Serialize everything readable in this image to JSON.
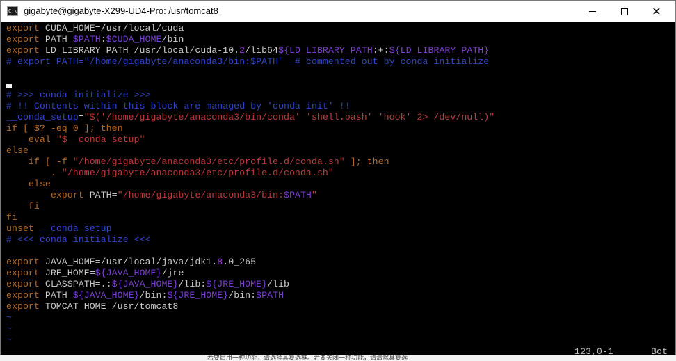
{
  "window": {
    "title": "gigabyte@gigabyte-X299-UD4-Pro: /usr/tomcat8",
    "icon": "console-icon",
    "controls": {
      "minimize": "minimize-icon",
      "maximize": "maximize-icon",
      "close": "close-icon"
    }
  },
  "colors": {
    "keyword": "#b2692a",
    "text": "#c8c8c8",
    "variable": "#7a3fd1",
    "comment": "#2f46c8",
    "string": "#bb3a3a",
    "blue_ident": "#2f46c8",
    "number": "#9a3fd1",
    "tilde": "#2f46c8",
    "cursor": "#f0f0f0"
  },
  "editor": {
    "lines": [
      [
        {
          "t": "export",
          "c": "keyword"
        },
        {
          "t": " CUDA_HOME=/usr/local/cuda",
          "c": "text"
        }
      ],
      [
        {
          "t": "export",
          "c": "keyword"
        },
        {
          "t": " PATH=",
          "c": "text"
        },
        {
          "t": "$PATH",
          "c": "variable"
        },
        {
          "t": ":",
          "c": "text"
        },
        {
          "t": "$CUDA_HOME",
          "c": "variable"
        },
        {
          "t": "/bin",
          "c": "text"
        }
      ],
      [
        {
          "t": "export",
          "c": "keyword"
        },
        {
          "t": " LD_LIBRARY_PATH=/usr/local/cuda-10.",
          "c": "text"
        },
        {
          "t": "2",
          "c": "number"
        },
        {
          "t": "/lib64",
          "c": "text"
        },
        {
          "t": "${LD_LIBRARY_PATH",
          ":": "",
          "c": "variable"
        },
        {
          "t": ":+:",
          "c": "text"
        },
        {
          "t": "${LD_LIBRARY_PATH}",
          "c": "variable"
        }
      ],
      [
        {
          "t": "# export PATH=\"/home/gigabyte/anaconda3/bin:$PATH\"  # commented out by conda initialize",
          "c": "comment"
        }
      ],
      [],
      [
        {
          "t": "",
          "c": "cursor"
        }
      ],
      [
        {
          "t": "# >>> conda initialize >>>",
          "c": "comment"
        }
      ],
      [
        {
          "t": "# !! Contents within this block are managed by 'conda init' !!",
          "c": "comment"
        }
      ],
      [
        {
          "t": "__conda_setup",
          "c": "blue_ident"
        },
        {
          "t": "=",
          "c": "text"
        },
        {
          "t": "\"$('/home/gigabyte/anaconda3/bin/conda' 'shell.bash' 'hook' 2> /dev/null)\"",
          "c": "string"
        }
      ],
      [
        {
          "t": "if [ $? -eq 0 ]; then",
          "c": "keyword"
        }
      ],
      [
        {
          "t": "    eval ",
          "c": "keyword"
        },
        {
          "t": "\"$__conda_setup\"",
          "c": "string"
        }
      ],
      [
        {
          "t": "else",
          "c": "keyword"
        }
      ],
      [
        {
          "t": "    if [ -f ",
          "c": "keyword"
        },
        {
          "t": "\"/home/gigabyte/anaconda3/etc/profile.d/conda.sh\"",
          "c": "string"
        },
        {
          "t": " ]; then",
          "c": "keyword"
        }
      ],
      [
        {
          "t": "        . ",
          "c": "keyword"
        },
        {
          "t": "\"/home/gigabyte/anaconda3/etc/profile.d/conda.sh\"",
          "c": "string"
        }
      ],
      [
        {
          "t": "    else",
          "c": "keyword"
        }
      ],
      [
        {
          "t": "        export",
          "c": "keyword"
        },
        {
          "t": " PATH=",
          "c": "text"
        },
        {
          "t": "\"/home/gigabyte/anaconda3/bin:",
          "c": "string"
        },
        {
          "t": "$PATH",
          "c": "variable"
        },
        {
          "t": "\"",
          "c": "string"
        }
      ],
      [
        {
          "t": "    fi",
          "c": "keyword"
        }
      ],
      [
        {
          "t": "fi",
          "c": "keyword"
        }
      ],
      [
        {
          "t": "unset",
          "c": "keyword"
        },
        {
          "t": " __conda_setup",
          "c": "blue_ident"
        }
      ],
      [
        {
          "t": "# <<< conda initialize <<<",
          "c": "comment"
        }
      ],
      [],
      [
        {
          "t": "export",
          "c": "keyword"
        },
        {
          "t": " JAVA_HOME=/usr/local/java/jdk1.",
          "c": "text"
        },
        {
          "t": "8",
          "c": "number"
        },
        {
          "t": ".0_265",
          "c": "text"
        }
      ],
      [
        {
          "t": "export",
          "c": "keyword"
        },
        {
          "t": " JRE_HOME=",
          "c": "text"
        },
        {
          "t": "${JAVA_HOME}",
          "c": "variable"
        },
        {
          "t": "/jre",
          "c": "text"
        }
      ],
      [
        {
          "t": "export",
          "c": "keyword"
        },
        {
          "t": " CLASSPATH=.:",
          "c": "text"
        },
        {
          "t": "${JAVA_HOME}",
          "c": "variable"
        },
        {
          "t": "/lib:",
          "c": "text"
        },
        {
          "t": "${JRE_HOME}",
          "c": "variable"
        },
        {
          "t": "/lib",
          "c": "text"
        }
      ],
      [
        {
          "t": "export",
          "c": "keyword"
        },
        {
          "t": " PATH=",
          "c": "text"
        },
        {
          "t": "${JAVA_HOME}",
          "c": "variable"
        },
        {
          "t": "/bin:",
          "c": "text"
        },
        {
          "t": "${JRE_HOME}",
          "c": "variable"
        },
        {
          "t": "/bin:",
          "c": "text"
        },
        {
          "t": "$PATH",
          "c": "variable"
        }
      ],
      [
        {
          "t": "export",
          "c": "keyword"
        },
        {
          "t": " TOMCAT_HOME=/usr/tomcat8",
          "c": "text"
        }
      ],
      [
        {
          "t": "~",
          "c": "tilde"
        }
      ],
      [
        {
          "t": "~",
          "c": "tilde"
        }
      ],
      [
        {
          "t": "~",
          "c": "tilde"
        }
      ]
    ]
  },
  "statusline": {
    "position": "123,0-1",
    "scroll": "Bot"
  },
  "background_strip": {
    "left_text": "...",
    "segments": [
      "若要启用一种功能，请选择其复选框。若要关闭一种功能，请清除其复选"
    ]
  }
}
